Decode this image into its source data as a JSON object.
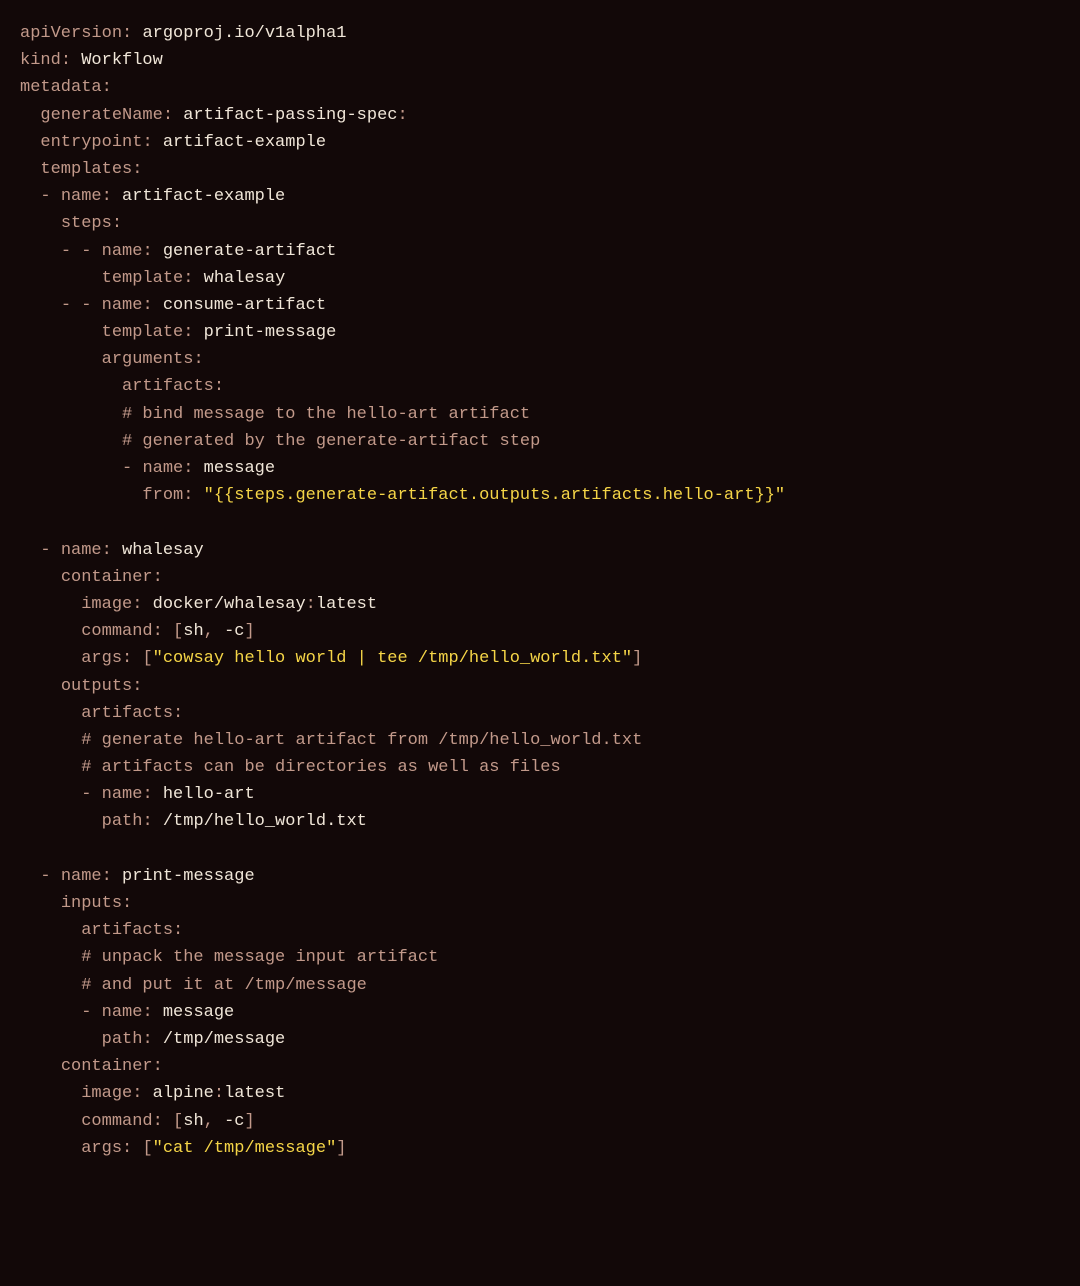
{
  "yaml": {
    "apiVersion": "argoproj.io/v1alpha1",
    "kind": "Workflow",
    "metadata": {
      "generateName": "artifact-passing-spec",
      "entrypoint": "artifact-example"
    },
    "templates": [
      {
        "name": "artifact-example",
        "steps": [
          {
            "name": "generate-artifact",
            "template": "whalesay"
          },
          {
            "name": "consume-artifact",
            "template": "print-message",
            "arguments": {
              "artifacts": {
                "comment1": "# bind message to the hello-art artifact",
                "comment2": "# generated by the generate-artifact step",
                "name": "message",
                "from": "\"{{steps.generate-artifact.outputs.artifacts.hello-art}}\""
              }
            }
          }
        ]
      },
      {
        "name": "whalesay",
        "container": {
          "image_repo": "docker/whalesay",
          "image_tag": "latest",
          "command": "[sh, -c]",
          "args": "[\"cowsay hello world | tee /tmp/hello_world.txt\"]"
        },
        "outputs": {
          "artifacts": {
            "comment1": "# generate hello-art artifact from /tmp/hello_world.txt",
            "comment2": "# artifacts can be directories as well as files",
            "name": "hello-art",
            "path": "/tmp/hello_world.txt"
          }
        }
      },
      {
        "name": "print-message",
        "inputs": {
          "artifacts": {
            "comment1": "# unpack the message input artifact",
            "comment2": "# and put it at /tmp/message",
            "name": "message",
            "path": "/tmp/message"
          }
        },
        "container": {
          "image_repo": "alpine",
          "image_tag": "latest",
          "command": "[sh, -c]",
          "args": "[\"cat /tmp/message\"]"
        }
      }
    ]
  },
  "labels": {
    "apiVersion": "apiVersion",
    "kind": "kind",
    "metadata": "metadata",
    "generateName": "generateName",
    "entrypoint": "entrypoint",
    "templates": "templates",
    "name": "name",
    "steps": "steps",
    "template": "template",
    "arguments": "arguments",
    "artifacts": "artifacts",
    "from": "from",
    "container": "container",
    "image": "image",
    "command": "command",
    "args": "args",
    "outputs": "outputs",
    "path": "path",
    "inputs": "inputs"
  },
  "punct": {
    "colon": ":",
    "dash": "-",
    "lbracket": "[",
    "rbracket": "]",
    "comma": ",",
    "quote": "\""
  },
  "cmd": {
    "sh": "sh",
    "dashc": "-c"
  }
}
